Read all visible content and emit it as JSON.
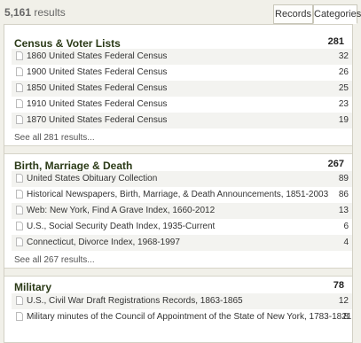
{
  "results": {
    "count": "5,161",
    "suffix": "results"
  },
  "tabs": {
    "records": "Records",
    "categories": "Categories"
  },
  "sections": [
    {
      "title": "Census & Voter Lists",
      "total": "281",
      "items": [
        {
          "label": "1860 United States Federal Census",
          "count": "32"
        },
        {
          "label": "1900 United States Federal Census",
          "count": "26"
        },
        {
          "label": "1850 United States Federal Census",
          "count": "25"
        },
        {
          "label": "1910 United States Federal Census",
          "count": "23"
        },
        {
          "label": "1870 United States Federal Census",
          "count": "19"
        }
      ],
      "see_all": "See all 281 results..."
    },
    {
      "title": "Birth, Marriage & Death",
      "total": "267",
      "items": [
        {
          "label": "United States Obituary Collection",
          "count": "89"
        },
        {
          "label": "Historical Newspapers, Birth, Marriage, & Death Announcements, 1851-2003",
          "count": "86"
        },
        {
          "label": "Web: New York, Find A Grave Index, 1660-2012",
          "count": "13"
        },
        {
          "label": "U.S., Social Security Death Index, 1935-Current",
          "count": "6"
        },
        {
          "label": "Connecticut, Divorce Index, 1968-1997",
          "count": "4"
        }
      ],
      "see_all": "See all 267 results..."
    },
    {
      "title": "Military",
      "total": "78",
      "items": [
        {
          "label": "U.S., Civil War Draft Registrations Records, 1863-1865",
          "count": "12"
        },
        {
          "label": "Military minutes of the Council of Appointment of the State of New York, 1783-1821",
          "count": "8"
        }
      ]
    }
  ]
}
